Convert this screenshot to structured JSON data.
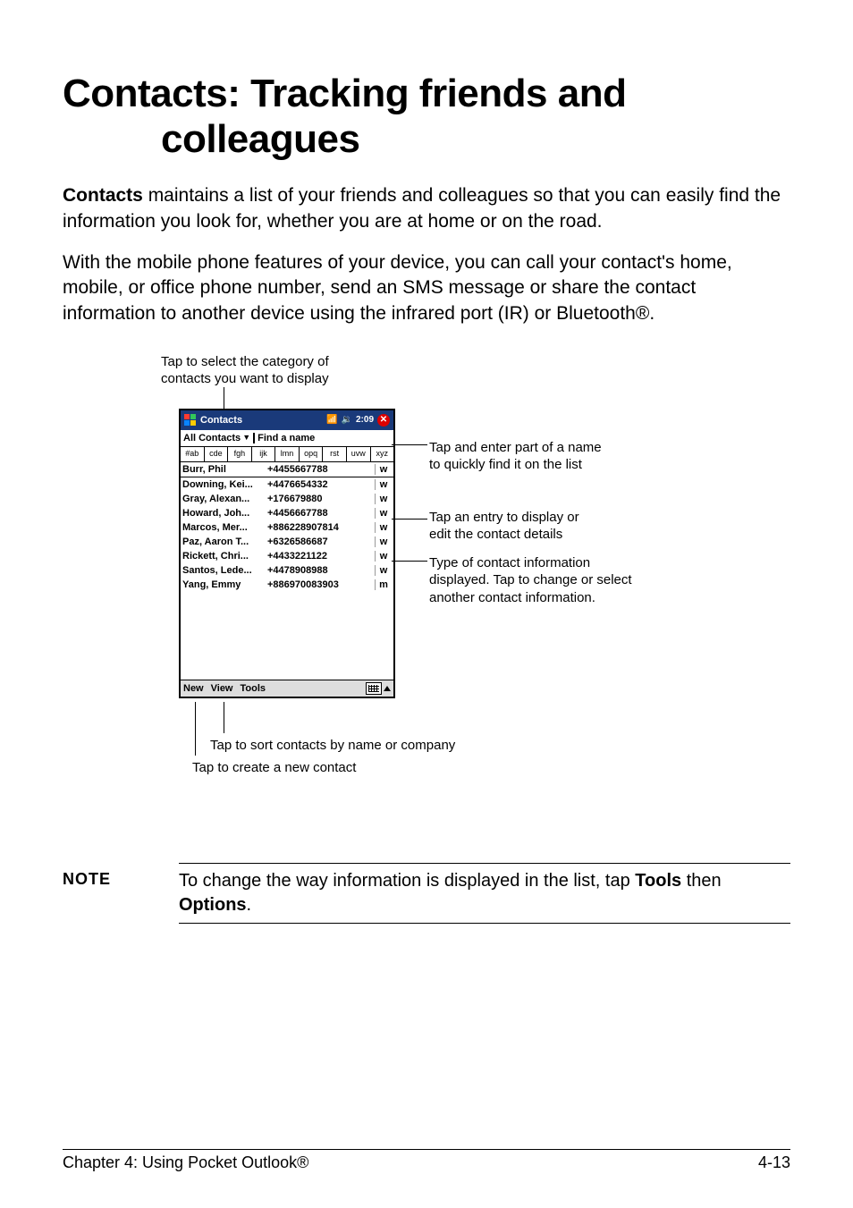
{
  "title_line1": "Contacts: Tracking friends and",
  "title_line2": "colleagues",
  "para1_lead": "Contacts",
  "para1_rest": " maintains a list of your friends and colleagues so that you can easily find the information you look for, whether you are at home or on the road.",
  "para2": "With the mobile phone features of your device, you can call your contact's home, mobile, or office phone number, send an SMS message or share the contact information to another device using the infrared port (IR) or Bluetooth®.",
  "cap_top_l1": "Tap to select the category of",
  "cap_top_l2": "contacts you want to display",
  "device": {
    "title": "Contacts",
    "time": "2:09",
    "category": "All Contacts",
    "find_label": "Find a name",
    "alpha": [
      "#ab",
      "cde",
      "fgh",
      "ijk",
      "lmn",
      "opq",
      "rst",
      "uvw",
      "xyz"
    ],
    "rows": [
      {
        "name": "Burr, Phil",
        "num": "+4455667788",
        "t": "w"
      },
      {
        "name": "Downing, Kei...",
        "num": "+4476654332",
        "t": "w"
      },
      {
        "name": "Gray, Alexan...",
        "num": "+176679880",
        "t": "w"
      },
      {
        "name": "Howard, Joh...",
        "num": "+4456667788",
        "t": "w"
      },
      {
        "name": "Marcos, Mer...",
        "num": "+886228907814",
        "t": "w"
      },
      {
        "name": "Paz, Aaron T...",
        "num": "+6326586687",
        "t": "w"
      },
      {
        "name": "Rickett, Chri...",
        "num": "+4433221122",
        "t": "w"
      },
      {
        "name": "Santos, Lede...",
        "num": "+4478908988",
        "t": "w"
      },
      {
        "name": "Yang, Emmy",
        "num": "+886970083903",
        "t": "m"
      }
    ],
    "menu_new": "New",
    "menu_view": "View",
    "menu_tools": "Tools"
  },
  "callout1_l1": "Tap and enter part of a name",
  "callout1_l2": "to quickly find it on the list",
  "callout2_l1": "Tap an entry to display or",
  "callout2_l2": "edit the contact details",
  "callout3_l1": "Type of contact information",
  "callout3_l2": "displayed. Tap to change or select",
  "callout3_l3": "another contact information.",
  "cap_sort": "Tap to sort contacts by name or company",
  "cap_new": "Tap to create a new contact",
  "note_label": "NOTE",
  "note_text_1": "To change the way information is displayed in the list, tap ",
  "note_bold1": "Tools",
  "note_text_2": " then ",
  "note_bold2": "Options",
  "note_text_3": ".",
  "footer_left": "Chapter 4: Using Pocket Outlook®",
  "footer_right": "4-13"
}
